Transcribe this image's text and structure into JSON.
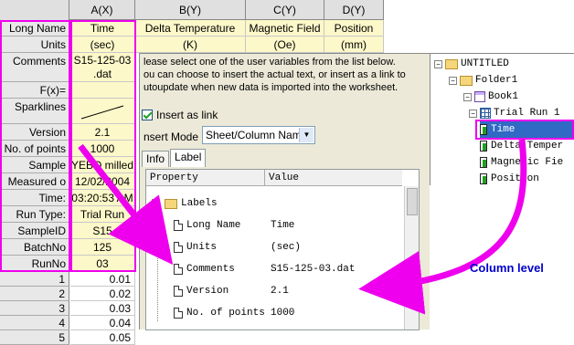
{
  "worksheet": {
    "columns": [
      {
        "header": "A(X)",
        "long_name": "Time",
        "units": "(sec)",
        "comments": "S15-125-03\n.dat",
        "version": "2.1",
        "num_points": "1000",
        "sample": "YEBO milled",
        "measured": "12/02/2004",
        "time": "03:20:53 AM",
        "run_type": "Trial Run",
        "sample_id": "S15",
        "batch_no": "125",
        "run_no": "03"
      },
      {
        "header": "B(Y)",
        "long_name": "Delta Temperature",
        "units": "(K)"
      },
      {
        "header": "C(Y)",
        "long_name": "Magnetic Field",
        "units": "(Oe)"
      },
      {
        "header": "D(Y)",
        "long_name": "Position",
        "units": "(mm)"
      }
    ],
    "row_labels": [
      "Long Name",
      "Units",
      "Comments",
      "F(x)=",
      "Sparklines",
      "Version",
      "No. of points",
      "Sample",
      "Measured o",
      "Time:",
      "Run Type:",
      "SampleID",
      "BatchNo",
      "RunNo"
    ],
    "data_rows": [
      {
        "index": "1",
        "value": "0.01"
      },
      {
        "index": "2",
        "value": "0.02"
      },
      {
        "index": "3",
        "value": "0.03"
      },
      {
        "index": "4",
        "value": "0.04"
      },
      {
        "index": "5",
        "value": "0.05"
      }
    ]
  },
  "dialog": {
    "instructions": "lease select one of the user variables from the list below.\nou can choose to insert the actual text, or insert as a link to\nutoupdate when new data is imported into the worksheet.",
    "insert_as_link_label": "Insert as link",
    "insert_mode_label": "nsert Mode",
    "insert_mode_value": "Sheet/Column Name",
    "tabs": [
      "Info",
      "Label"
    ],
    "grid_headers": [
      "Property",
      "Value"
    ],
    "group_label": "Labels",
    "properties": [
      {
        "name": "Long Name",
        "value": "Time"
      },
      {
        "name": "Units",
        "value": "(sec)"
      },
      {
        "name": "Comments",
        "value": "S15-125-03.dat"
      },
      {
        "name": "Version",
        "value": "2.1"
      },
      {
        "name": "No. of points",
        "value": "1000"
      }
    ]
  },
  "project_tree": {
    "items": [
      "UNTITLED",
      "Folder1",
      "Book1",
      "Trial Run 1",
      "Time",
      "Delta Temper",
      "Magnetic Fie",
      "Position"
    ]
  },
  "annotation": {
    "column_level": "Column level",
    "marker_color": "#ee00ee"
  }
}
